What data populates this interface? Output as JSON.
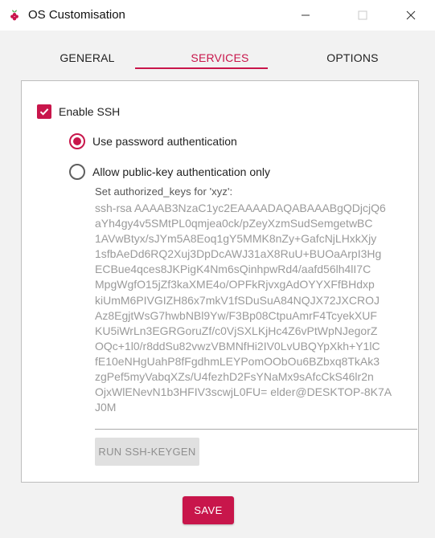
{
  "window": {
    "title": "OS Customisation",
    "icon": "raspberry-pi-icon"
  },
  "tabs": [
    {
      "label": "GENERAL",
      "active": false
    },
    {
      "label": "SERVICES",
      "active": true
    },
    {
      "label": "OPTIONS",
      "active": false
    }
  ],
  "services": {
    "enable_ssh": {
      "label": "Enable SSH",
      "checked": true
    },
    "password_auth": {
      "label": "Use password authentication",
      "selected": true
    },
    "pubkey_auth": {
      "label": "Allow public-key authentication only",
      "selected": false
    },
    "authorized_keys_label": "Set authorized_keys for 'xyz':",
    "authorized_keys_value": "ssh-rsa AAAAB3NzaC1yc2EAAAADAQABAAABgQDjcjQ6\naYh4gy4v5SMtPL0qmjea0ck/pZeyXzmSudSemgetwBC\n1AVwBtyx/sJYm5A8Eoq1gY5MMK8nZy+GafcNjLHxkXjy\n1sfbAeDd6RQ2Xuj3DpDcAWJ31aX8RuU+BUOaArpI3Hg\nECBue4qces8JKPigK4Nm6sQinhpwRd4/aafd56lh4lI7C\nMpgWgfO15jZf3kaXME4o/OPFkRjvxgAdOYYXFfBHdxp\nkiUmM6PIVGIZH86x7mkV1fSDuSuA84NQJX72JXCROJ\nAz8EgjtWsG7hwbNBl9Yw/F3Bp08CtpuAmrF4TcyekXUF\nKU5iWrLn3EGRGoruZf/c0VjSXLKjHc4Z6vPtWpNJegorZ\nOQc+1l0/r8ddSu82vwzVBMNfHi2IV0LvUBQYpXkh+Y1lC\nfE10eNHgUahP8fFgdhmLEYPomOObOu6BZbxq8TkAk3\nzgPef5myVabqXZs/U4fezhD2FsYNaMx9sAfcCkS46lr2n\nOjxWlENevN1b3HFIV3scwjL0FU= elder@DESKTOP-8K7A\nJ0M",
    "keygen_label": "RUN SSH-KEYGEN"
  },
  "save_label": "SAVE",
  "colors": {
    "accent": "#c8164b",
    "disabled_text": "#9a9a9a",
    "panel_bg": "#f2f2f2"
  }
}
